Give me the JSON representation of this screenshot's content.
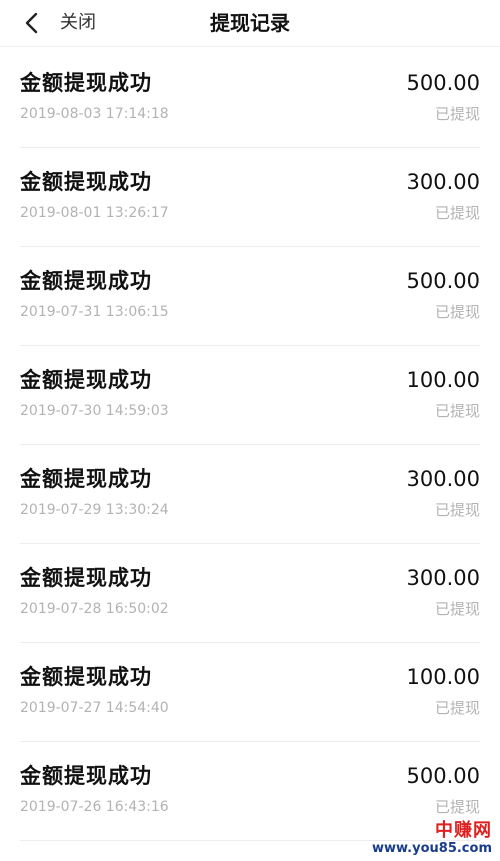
{
  "header": {
    "back_icon": "chevron-left-icon",
    "close_label": "关闭",
    "title": "提现记录"
  },
  "records": [
    {
      "title": "金额提现成功",
      "time": "2019-08-03 17:14:18",
      "amount": "500.00",
      "status": "已提现"
    },
    {
      "title": "金额提现成功",
      "time": "2019-08-01 13:26:17",
      "amount": "300.00",
      "status": "已提现"
    },
    {
      "title": "金额提现成功",
      "time": "2019-07-31 13:06:15",
      "amount": "500.00",
      "status": "已提现"
    },
    {
      "title": "金额提现成功",
      "time": "2019-07-30 14:59:03",
      "amount": "100.00",
      "status": "已提现"
    },
    {
      "title": "金额提现成功",
      "time": "2019-07-29 13:30:24",
      "amount": "300.00",
      "status": "已提现"
    },
    {
      "title": "金额提现成功",
      "time": "2019-07-28 16:50:02",
      "amount": "300.00",
      "status": "已提现"
    },
    {
      "title": "金额提现成功",
      "time": "2019-07-27 14:54:40",
      "amount": "100.00",
      "status": "已提现"
    },
    {
      "title": "金额提现成功",
      "time": "2019-07-26 16:43:16",
      "amount": "500.00",
      "status": "已提现"
    }
  ],
  "watermark": {
    "name": "中赚网",
    "url": "www.you85.com"
  },
  "colors": {
    "text_primary": "#111111",
    "text_secondary": "#b3b3b3",
    "divider": "#ececec",
    "watermark_red": "#e02020",
    "watermark_blue": "#1a3c8c"
  }
}
